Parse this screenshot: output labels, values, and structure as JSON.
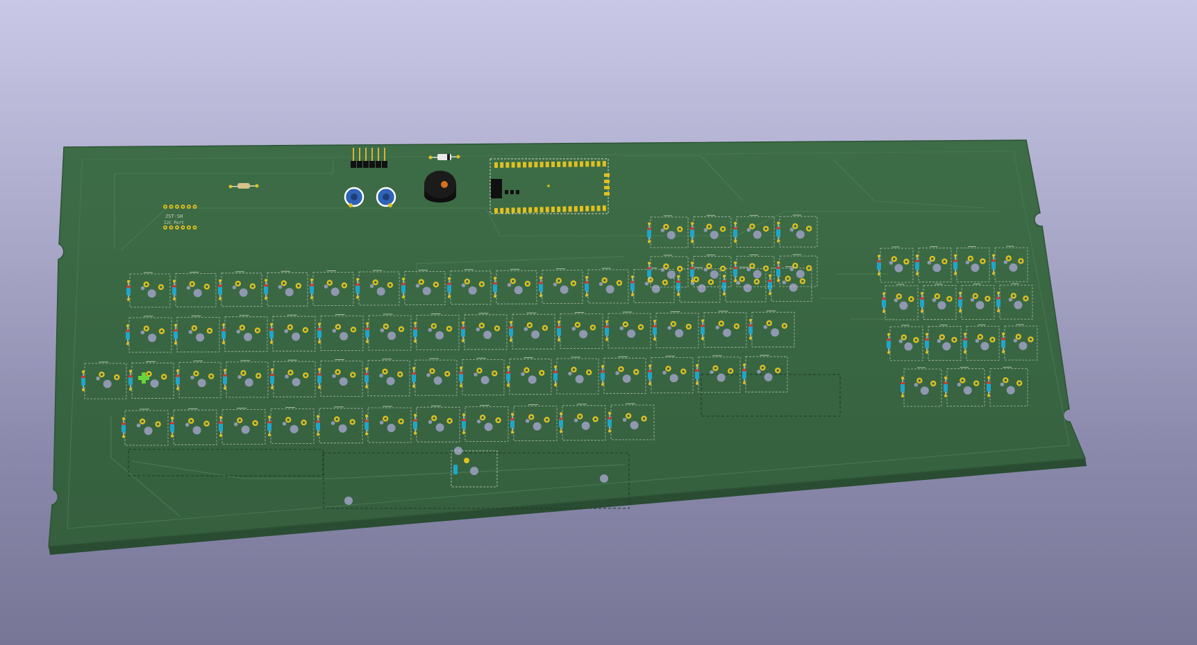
{
  "viewer": {
    "background_top": "#c9c8e6",
    "background_bottom": "#777697"
  },
  "board": {
    "substrate_color": "#2e5b3a",
    "mask_color": "#3b6b44",
    "silkscreen_color": "#cfd6c4",
    "pad_color": "#e0c020",
    "labels": {
      "connector": "JST-SH",
      "connector_sub": "I2C Port",
      "corner_top": "",
      "corner_mid": "",
      "corner_bottom": ""
    }
  },
  "components": [
    {
      "name": "resistor-r1",
      "kind": "resistor"
    },
    {
      "name": "header-j1",
      "kind": "pin-header"
    },
    {
      "name": "capacitor-c1",
      "kind": "electrolytic-capacitor"
    },
    {
      "name": "capacitor-c2",
      "kind": "electrolytic-capacitor"
    },
    {
      "name": "diode-d0",
      "kind": "diode"
    },
    {
      "name": "buzzer-bz1",
      "kind": "buzzer"
    },
    {
      "name": "mcu-module-u1",
      "kind": "microcontroller-module"
    },
    {
      "name": "jst-connector",
      "kind": "connector"
    }
  ]
}
